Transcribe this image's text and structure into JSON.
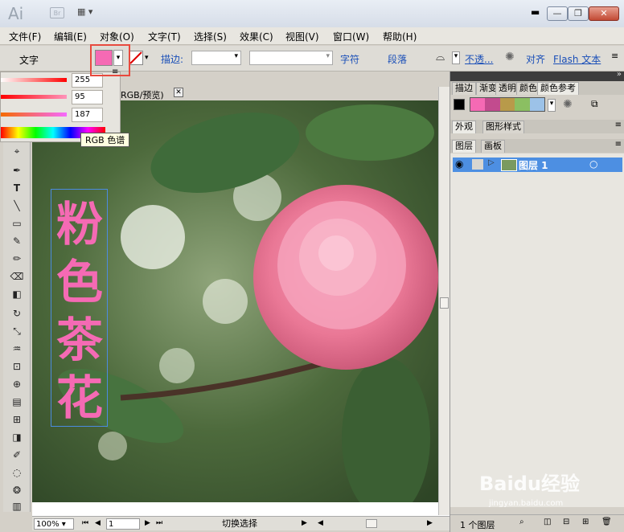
{
  "app": {
    "logo": "Ai",
    "bridge": "Br"
  },
  "window_controls": {
    "minimize": "—",
    "restore": "❐",
    "close": "✕",
    "help_minimize": "▬"
  },
  "menu": [
    "文件(F)",
    "编辑(E)",
    "对象(O)",
    "文字(T)",
    "选择(S)",
    "效果(C)",
    "视图(V)",
    "窗口(W)",
    "帮助(H)"
  ],
  "control": {
    "label": "文字",
    "fill_color": "#f56ab4",
    "stroke_label": "描边:",
    "char_label": "字符",
    "para_label": "段落",
    "opacity_label": "不透...",
    "align_label": "对齐",
    "flash_label": "Flash 文本"
  },
  "swatch": {
    "r": "255",
    "g": "95",
    "b": "187",
    "tooltip": "RGB 色谱"
  },
  "document": {
    "tab_label": "RGB/预览)",
    "artwork_text": [
      "粉",
      "色",
      "茶",
      "花"
    ],
    "text_color": "#f56ab4"
  },
  "panels": {
    "top_tabs": [
      "描边",
      "渐变",
      "透明",
      "颜色",
      "颜色参考"
    ],
    "guide_colors": [
      "#f56ab4",
      "#c24b8e",
      "#b89a4a",
      "#8bbf62",
      "#9cc2e8"
    ],
    "appearance_tabs": [
      "外观",
      "图形样式"
    ],
    "layer_tabs": [
      "图层",
      "画板"
    ],
    "layer_name": "图层 1",
    "layer_count": "1 个图层"
  },
  "statusbar": {
    "zoom": "100%",
    "page": "1",
    "tool_text": "切换选择"
  },
  "watermark": {
    "brand": "Baidu经验",
    "url": "jingyan.baidu.com"
  }
}
